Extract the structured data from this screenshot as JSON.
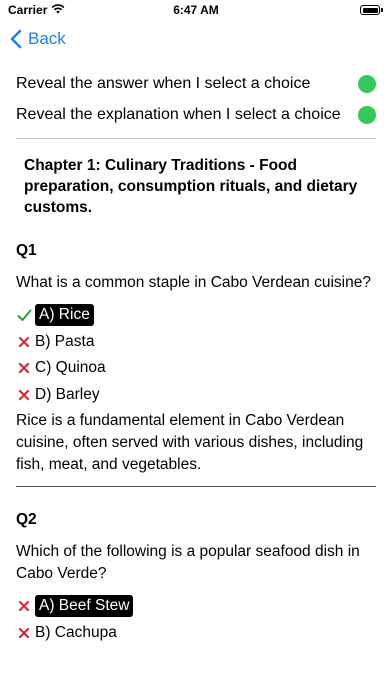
{
  "status": {
    "carrier": "Carrier",
    "time": "6:47 AM"
  },
  "nav": {
    "back_label": "Back"
  },
  "settings": {
    "reveal_answer": "Reveal the answer when I select a choice",
    "reveal_explanation": "Reveal the explanation when I select a choice",
    "toggle_color": "#34c759"
  },
  "chapter": {
    "title": "Chapter 1: Culinary Traditions - Food preparation, consumption rituals, and dietary customs."
  },
  "questions": [
    {
      "label": "Q1",
      "text": "What is a common staple in Cabo Verdean cuisine?",
      "choices": [
        {
          "text": "A) Rice",
          "mark": "check",
          "selected": true
        },
        {
          "text": "B) Pasta",
          "mark": "cross",
          "selected": false
        },
        {
          "text": "C) Quinoa",
          "mark": "cross",
          "selected": false
        },
        {
          "text": "D) Barley",
          "mark": "cross",
          "selected": false
        }
      ],
      "explanation": "Rice is a fundamental element in Cabo Verdean cuisine, often served with various dishes, including fish, meat, and vegetables."
    },
    {
      "label": "Q2",
      "text": "Which of the following is a popular seafood dish in Cabo Verde?",
      "choices": [
        {
          "text": "A) Beef Stew",
          "mark": "cross",
          "selected": true
        },
        {
          "text": "B) Cachupa",
          "mark": "cross",
          "selected": false
        }
      ]
    }
  ],
  "colors": {
    "accent": "#1a7ff5",
    "correct": "#2e9e3e",
    "wrong": "#d7263d"
  }
}
